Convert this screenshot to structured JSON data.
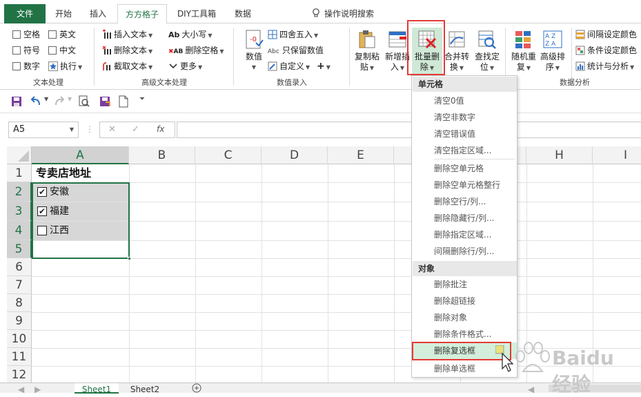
{
  "tabs": {
    "file": "文件",
    "home": "开始",
    "insert": "插入",
    "fangfang": "方方格子",
    "diy": "DIY工具箱",
    "data": "数据",
    "search": "操作说明搜索"
  },
  "ribbon": {
    "text_group": {
      "label": "文本处理",
      "items": [
        "空格",
        "英文",
        "符号",
        "中文",
        "数字",
        "执行"
      ]
    },
    "adv_text_group": {
      "label": "高级文本处理",
      "items": [
        "插入文本",
        "删除文本",
        "截取文本",
        "大小写",
        "删除空格",
        "更多"
      ]
    },
    "number_group": {
      "label": "数值录入",
      "value_btn": "数值",
      "items": [
        "四舍五入",
        "只保留数值",
        "自定义",
        "+"
      ]
    },
    "big_buttons": {
      "copy_paste": "复制粘贴",
      "add_insert": "新增插入",
      "batch_delete": "批量删除",
      "merge_convert": "合并转换",
      "find_locate": "查找定位",
      "random_repeat": "随机重复",
      "advanced_sort": "高级排序"
    },
    "data_analysis_group": {
      "label": "数据分析",
      "items": [
        "间隔设定颜色",
        "条件设定颜色",
        "统计与分析"
      ]
    }
  },
  "formula_bar": {
    "name_box": "A5",
    "fx": "fx"
  },
  "grid": {
    "columns": [
      "A",
      "B",
      "C",
      "D",
      "E",
      "F",
      "G",
      "H",
      "I"
    ],
    "rows": [
      "1",
      "2",
      "3",
      "4",
      "5",
      "6",
      "7",
      "8",
      "9",
      "10",
      "11",
      "12"
    ],
    "cells": {
      "a1": "专卖店地址",
      "checkboxes": [
        {
          "label": "安徽",
          "checked": true
        },
        {
          "label": "福建",
          "checked": true
        },
        {
          "label": "江西",
          "checked": false
        }
      ]
    }
  },
  "sheets": [
    "Sheet1",
    "Sheet2"
  ],
  "dropdown": {
    "header_cells": "单元格",
    "cell_items": [
      "清空0值",
      "清空非数字",
      "清空错误值",
      "清空指定区域...",
      "删除空单元格",
      "删除空单元格整行",
      "删除空行/列...",
      "删除隐藏行/列...",
      "删除指定区域...",
      "间隔删除行/列..."
    ],
    "header_objects": "对象",
    "object_items": [
      "删除批注",
      "删除超链接",
      "删除对象",
      "删除条件格式...",
      "删除复选框",
      "删除单选框"
    ],
    "highlighted": "删除复选框"
  },
  "watermark": "Baidu 经验",
  "colors": {
    "excel_green": "#217346",
    "highlight_red": "#e53935",
    "menu_highlight": "#d3eedb"
  }
}
